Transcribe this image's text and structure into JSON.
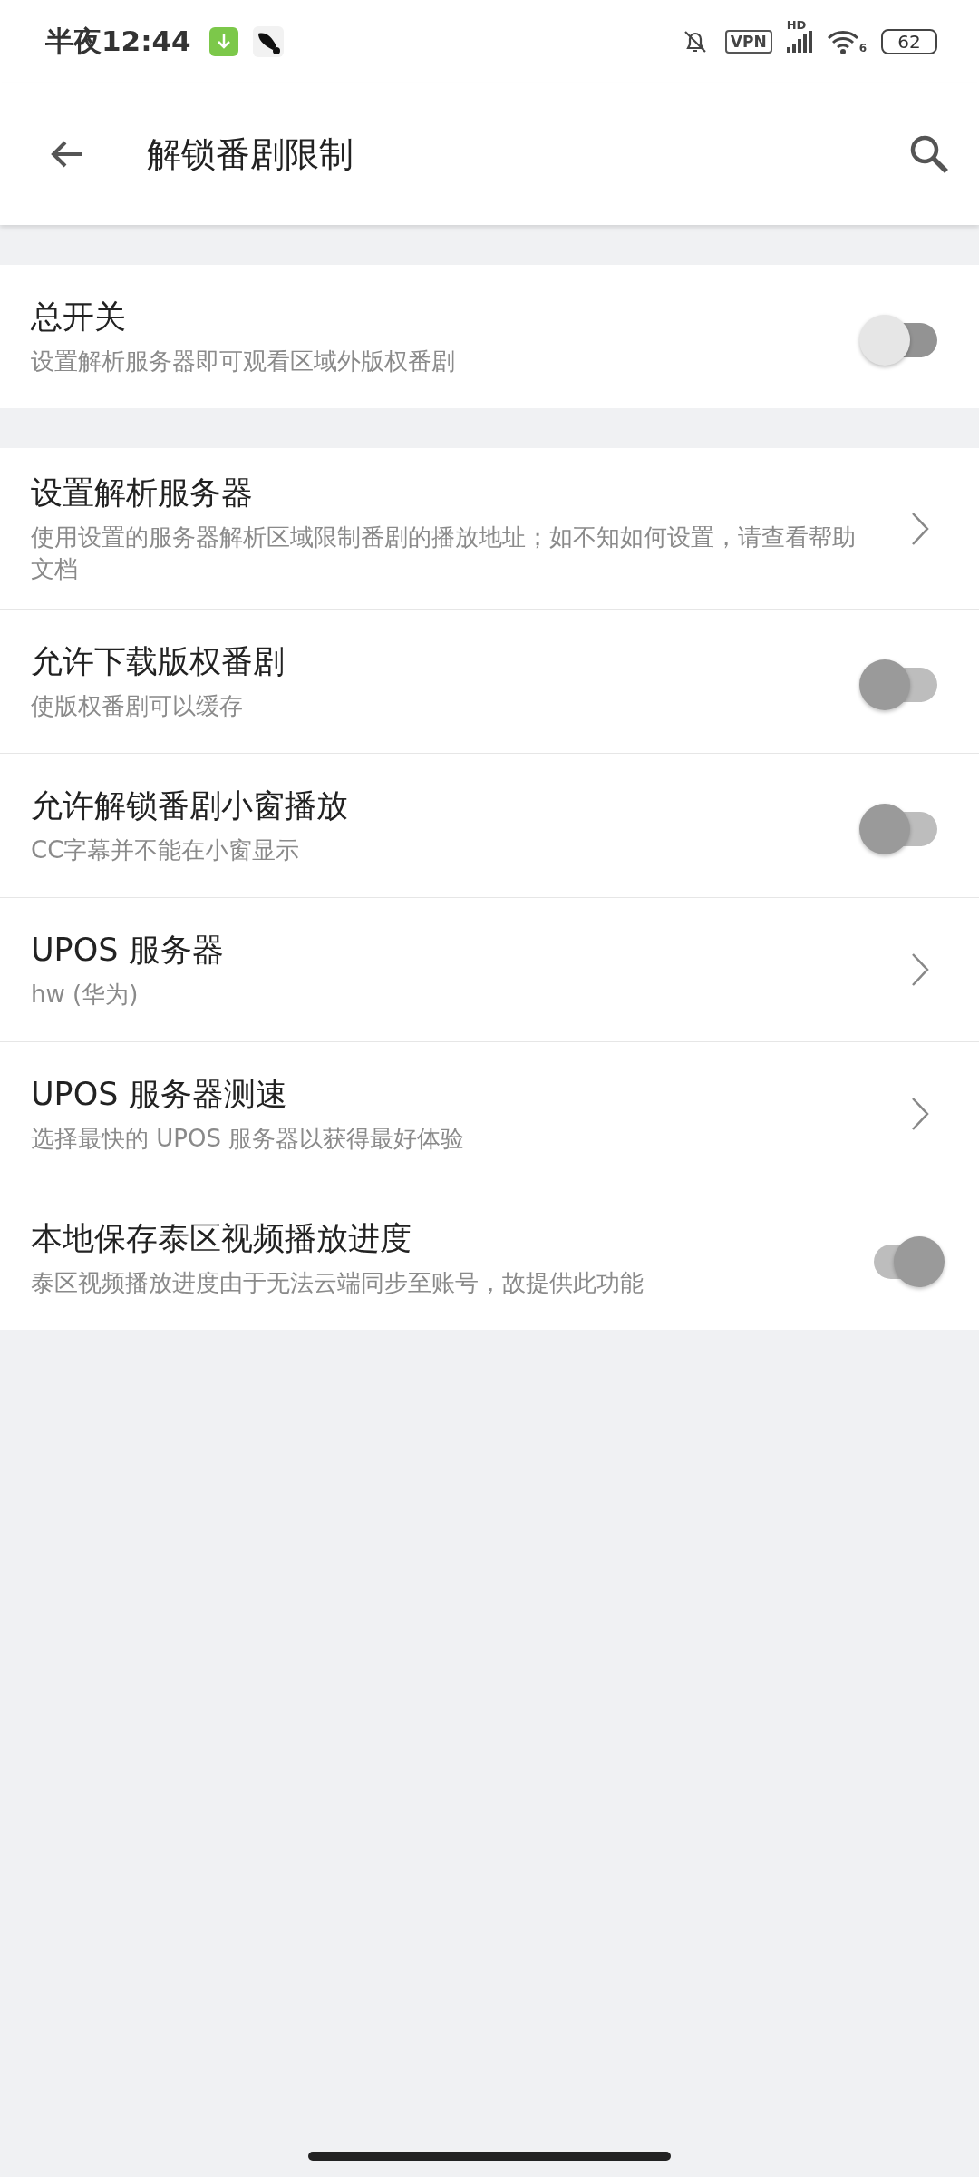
{
  "status_bar": {
    "time": "半夜12:44",
    "vpn": "VPN",
    "signal_label": "HD",
    "wifi_label": "6",
    "battery": "62"
  },
  "toolbar": {
    "title": "解锁番剧限制"
  },
  "sections": [
    {
      "items": [
        {
          "kind": "switch",
          "title": "总开关",
          "subtitle": "设置解析服务器即可观看区域外版权番剧",
          "checked": false,
          "disabled": false
        }
      ]
    },
    {
      "items": [
        {
          "kind": "link",
          "title": "设置解析服务器",
          "subtitle": "使用设置的服务器解析区域限制番剧的播放地址；如不知如何设置，请查看帮助文档"
        },
        {
          "kind": "switch",
          "title": "允许下载版权番剧",
          "subtitle": "使版权番剧可以缓存",
          "checked": false,
          "disabled": true
        },
        {
          "kind": "switch",
          "title": "允许解锁番剧小窗播放",
          "subtitle": "CC字幕并不能在小窗显示",
          "checked": false,
          "disabled": true
        },
        {
          "kind": "link",
          "title": "UPOS 服务器",
          "subtitle": "hw (华为)"
        },
        {
          "kind": "link",
          "title": "UPOS 服务器测速",
          "subtitle": "选择最快的 UPOS 服务器以获得最好体验"
        },
        {
          "kind": "switch",
          "title": "本地保存泰区视频播放进度",
          "subtitle": "泰区视频播放进度由于无法云端同步至账号，故提供此功能",
          "checked": true,
          "disabled": true
        }
      ]
    }
  ]
}
